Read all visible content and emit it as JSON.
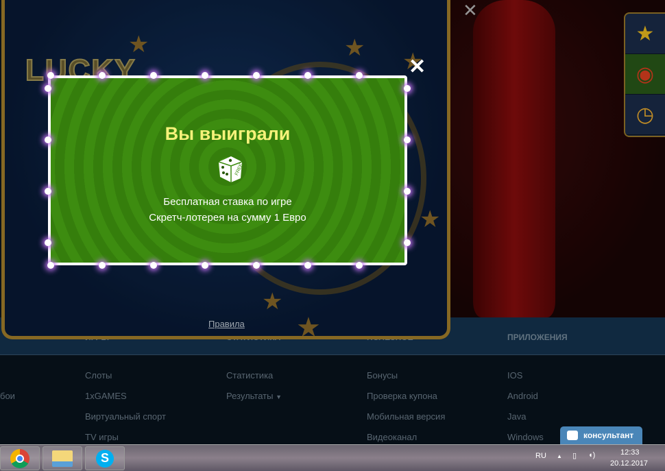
{
  "game": {
    "logo": "LUCKY",
    "rules_link": "Правила",
    "close_label": "✕"
  },
  "modal": {
    "title": "Вы выиграли",
    "icon": "free-dice-icon",
    "dice_label": "FREE",
    "line1": "Бесплатная ставка по игре",
    "line2": "Скретч-лотерея на сумму 1 Евро",
    "close_label": "✕"
  },
  "side_panel": {
    "items": [
      "stars-icon",
      "wheel-icon",
      "clock-icon"
    ]
  },
  "footer": {
    "headers": [
      "ИГРЫ",
      "СТАТИСТИКА",
      "ПОЛЕЗНОЕ",
      "ПРИЛОЖЕНИЯ"
    ],
    "col0": [
      "бои"
    ],
    "col1": [
      "Слоты",
      "1xGAMES",
      "Виртуальный спорт",
      "TV игры"
    ],
    "col2": [
      "Статистика",
      "Результаты"
    ],
    "col3": [
      "Бонусы",
      "Проверка купона",
      "Мобильная версия",
      "Видеоканал"
    ],
    "col4": [
      "IOS",
      "Android",
      "Java",
      "Windows"
    ]
  },
  "consultant": {
    "label": "консультант"
  },
  "taskbar": {
    "apps": [
      "chrome",
      "file-explorer",
      "skype"
    ],
    "lang": "RU",
    "time": "12:33",
    "date": "20.12.2017"
  }
}
